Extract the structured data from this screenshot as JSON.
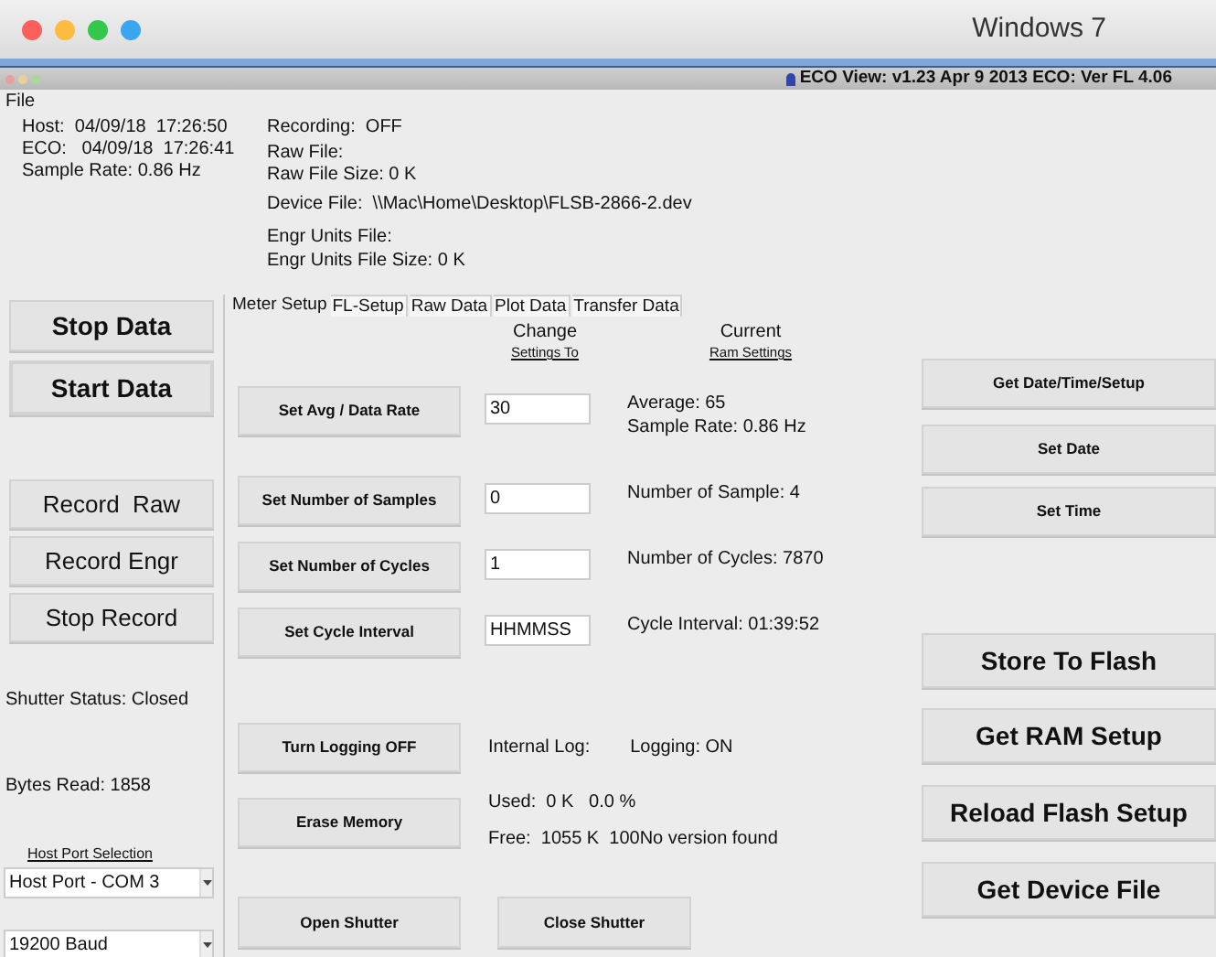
{
  "mac_window": {
    "title": "Windows 7"
  },
  "app_title": "ECO View:  v1.23 Apr  9 2013 ECO: Ver FL 4.06",
  "menu": [
    "File"
  ],
  "status_left": [
    "Host:  04/09/18  17:26:50",
    "ECO:   04/09/18  17:26:41",
    "Sample Rate: 0.86 Hz"
  ],
  "status_files": [
    "Recording:  OFF",
    "Raw File:",
    "Raw File Size: 0 K",
    "Device File:  \\\\Mac\\Home\\Desktop\\FLSB-2866-2.dev",
    "Engr Units File:",
    "Engr Units File Size: 0 K"
  ],
  "data_buttons": [
    {
      "label": "Stop Data",
      "focused": false
    },
    {
      "label": "Start Data",
      "focused": true
    }
  ],
  "record_buttons": [
    "Record  Raw",
    "Record Engr",
    "Stop Record"
  ],
  "shutter_status": "Shutter Status: Closed",
  "bytes_read": "Bytes Read: 1858",
  "host_port": {
    "heading": "Host Port Selection",
    "port": "Host Port - COM 3",
    "baud": "19200 Baud"
  },
  "tabs": [
    {
      "label": "Meter Setup",
      "selected": true
    },
    {
      "label": "FL-Setup",
      "selected": false
    },
    {
      "label": "Raw Data",
      "selected": false
    },
    {
      "label": "Plot Data",
      "selected": false
    },
    {
      "label": "Transfer Data",
      "selected": false
    }
  ],
  "headers": {
    "change": [
      "Change",
      "Settings To"
    ],
    "current": [
      "Current",
      "Ram Settings"
    ]
  },
  "settings": [
    {
      "button": "Set Avg / Data Rate",
      "value": "30",
      "current": [
        "Average: 65",
        "Sample Rate: 0.86 Hz"
      ]
    },
    {
      "button": "Set Number of Samples",
      "value": "0",
      "current": [
        "Number of Sample: 4"
      ]
    },
    {
      "button": "Set Number of Cycles",
      "value": "1",
      "current": [
        "Number of Cycles: 7870"
      ]
    },
    {
      "button": "Set Cycle Interval",
      "value": "HHMMSS",
      "current": [
        "Cycle Interval: 01:39:52"
      ]
    }
  ],
  "logging": {
    "button": "Turn Logging OFF",
    "label": "Internal Log:",
    "state": "Logging: ON"
  },
  "memory": {
    "button": "Erase Memory",
    "used": "Used:  0 K   0.0 %",
    "free": "Free:  1055 K  100No version found"
  },
  "shutter_buttons": [
    "Open Shutter",
    "Close Shutter"
  ],
  "device_buttons": [
    "Get Date/Time/Setup",
    "Set Date",
    "Set Time"
  ],
  "flash_buttons": [
    "Store To Flash",
    "Get RAM Setup",
    "Reload Flash Setup",
    "Get Device File"
  ]
}
